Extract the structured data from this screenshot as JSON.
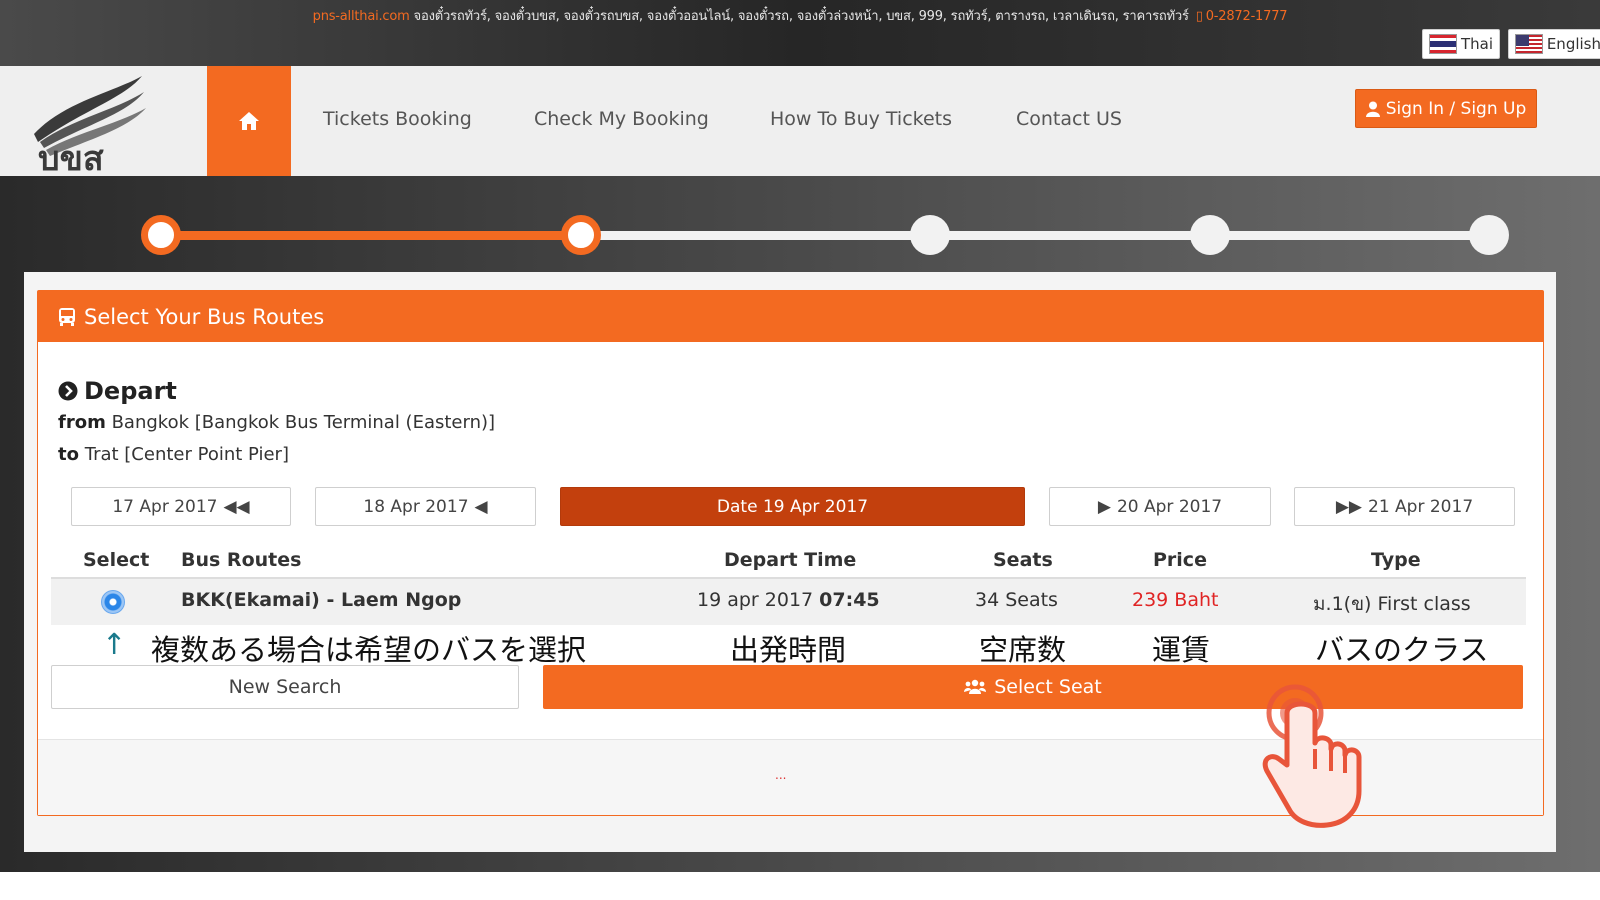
{
  "topbar": {
    "site": "pns-allthai.com",
    "tagline": "จองตั๋วรถทัวร์, จองตั๋วบขส, จองตั๋วรถบขส, จองตั๋วออนไลน์, จองตั๋วรถ, จองตั๋วล่วงหน้า, บขส, 999, รถทัวร์, ตารางรถ, เวลาเดินรถ, ราคารถทัวร์",
    "phone": "0-2872-1777",
    "lang_thai": "Thai",
    "lang_english": "English"
  },
  "nav": {
    "logo_text": "บขส",
    "items": [
      "Tickets Booking",
      "Check My Booking",
      "How To Buy Tickets",
      "Contact US"
    ],
    "signin": "Sign In / Sign Up"
  },
  "steps": {
    "total": 5,
    "current": 2
  },
  "card": {
    "title": "Select Your Bus Routes",
    "depart_title": "Depart",
    "from_label": "from",
    "from_value": "Bangkok [Bangkok Bus Terminal (Eastern)]",
    "to_label": "to",
    "to_value": "Trat [Center Point Pier]"
  },
  "dates": {
    "prev2": "17 Apr 2017",
    "prev1": "18 Apr 2017",
    "current": "Date 19 Apr 2017",
    "next1": "20 Apr 2017",
    "next2": "21 Apr 2017"
  },
  "table": {
    "headers": [
      "Select",
      "Bus Routes",
      "Depart Time",
      "Seats",
      "Price",
      "Type"
    ],
    "row": {
      "route": "BKK(Ekamai) - Laem Ngop",
      "date": "19 apr 2017",
      "time": "07:45",
      "seats": "34 Seats",
      "price": "239 Baht",
      "type": "ม.1(ข) First class"
    }
  },
  "annotations": {
    "arrow": "↑",
    "select": "複数ある場合は希望のバスを選択",
    "time": "出発時間",
    "seats": "空席数",
    "price": "運賃",
    "type": "バスのクラス"
  },
  "buttons": {
    "new_search": "New Search",
    "select_seat": "Select Seat"
  },
  "footer": {
    "dots": "..."
  },
  "colors": {
    "accent": "#f36a21",
    "active_date": "#c3400d",
    "price": "#e02424"
  }
}
